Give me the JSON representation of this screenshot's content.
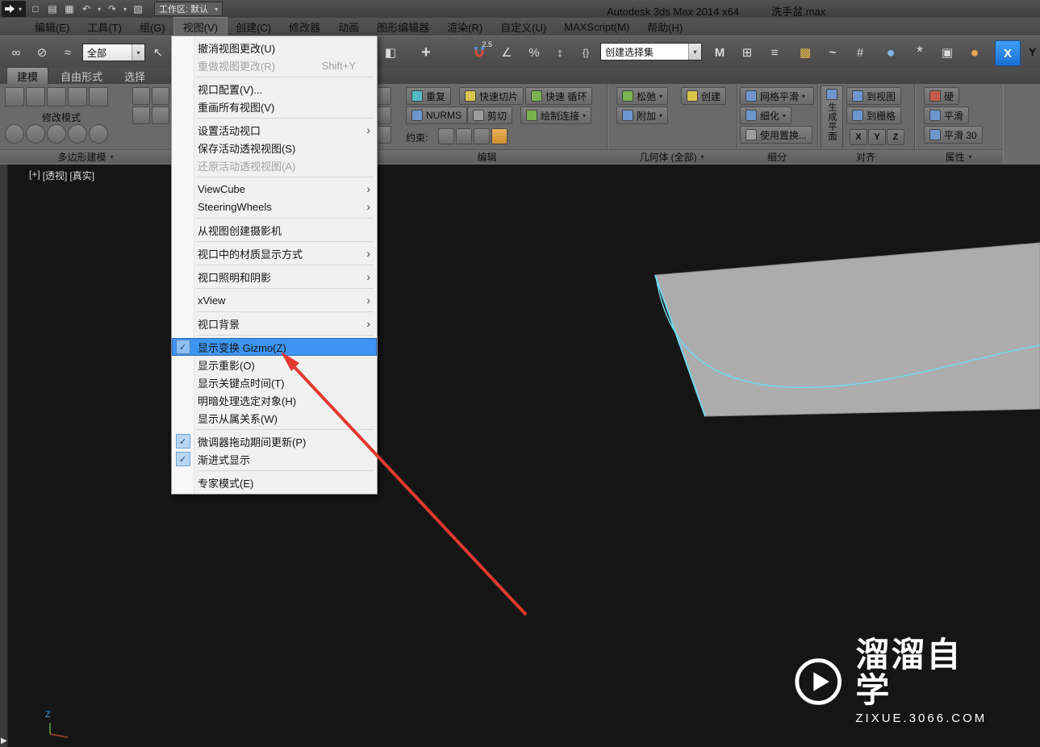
{
  "window": {
    "app_title": "Autodesk 3ds Max 2014 x64",
    "file_name": "洗手盆.max",
    "workspace_label": "工作区: 默认"
  },
  "menubar": {
    "items": [
      "编辑(E)",
      "工具(T)",
      "组(G)",
      "视图(V)",
      "创建(C)",
      "修改器",
      "动画",
      "图形编辑器",
      "渲染(R)",
      "自定义(U)",
      "MAXScript(M)",
      "帮助(H)"
    ]
  },
  "toolbar": {
    "selection_filter": "全部",
    "named_sets_value": "创建选择集",
    "snap_25": "2.5",
    "axis_x": "X",
    "axis_y": "Y"
  },
  "ribbon": {
    "tabs": [
      "建模",
      "自由形式",
      "选择"
    ],
    "polygon_panel": {
      "modify_mode": "修改模式",
      "label": "多边形建模"
    },
    "edit_panel": {
      "label": "编辑",
      "repeat": "重复",
      "quickslice": "快速切片",
      "swiftloop": "快速 循环",
      "nurms": "NURMS",
      "cut": "剪切",
      "paintconnect": "绘制连接",
      "constraints": "约束:"
    },
    "geometry_panel": {
      "label": "几何体 (全部)",
      "relax": "松弛",
      "attach": "附加",
      "create": "创建"
    },
    "subdivision_panel": {
      "label": "细分",
      "meshsmooth": "网格平滑",
      "tessellate": "细化",
      "displacement": "使用置换..."
    },
    "align_panel": {
      "label": "对齐",
      "make_planar": "生成平面",
      "to_view": "到视图",
      "to_grid": "到栅格",
      "x": "X",
      "y": "Y",
      "z": "Z"
    },
    "properties_panel": {
      "label": "属性",
      "hard": "硬",
      "smooth": "平滑",
      "smooth30": "平滑 30"
    }
  },
  "menu": {
    "items": [
      {
        "label": "撤消视图更改(U)"
      },
      {
        "label": "重做视图更改(R)",
        "shortcut": "Shift+Y",
        "disabled": true
      },
      {
        "label": "视口配置(V)..."
      },
      {
        "label": "重画所有视图(V)"
      },
      {
        "label": "设置活动视口",
        "submenu": true
      },
      {
        "label": "保存活动透视视图(S)"
      },
      {
        "label": "还原活动透视视图(A)",
        "disabled": true
      },
      {
        "label": "ViewCube",
        "submenu": true
      },
      {
        "label": "SteeringWheels",
        "submenu": true
      },
      {
        "label": "从视图创建摄影机"
      },
      {
        "label": "视口中的材质显示方式",
        "submenu": true
      },
      {
        "label": "视口照明和阴影",
        "submenu": true
      },
      {
        "label": "xView",
        "submenu": true
      },
      {
        "label": "视口背景",
        "submenu": true
      },
      {
        "label": "显示变换 Gizmo(Z)",
        "checked": true,
        "highlighted": true
      },
      {
        "label": "显示重影(O)"
      },
      {
        "label": "显示关键点时间(T)"
      },
      {
        "label": "明暗处理选定对象(H)"
      },
      {
        "label": "显示从属关系(W)"
      },
      {
        "label": "微调器拖动期间更新(P)",
        "checked": true
      },
      {
        "label": "渐进式显示",
        "checked": true
      },
      {
        "label": "专家模式(E)"
      }
    ]
  },
  "viewport": {
    "general_label": "[+]",
    "pov_label": "[透视]",
    "shading_label": "[真实]",
    "axis_z": "Z"
  },
  "watermark": {
    "name": "溜溜自学",
    "site": "ZIXUE.3066.COM"
  },
  "icons": {
    "caret": "▾",
    "submenu": "›",
    "check": "✓",
    "new_doc": "□",
    "open_folder": "▤",
    "save": "▦",
    "undo": "↶",
    "redo": "↷",
    "project_folder": "▧",
    "link": "∞",
    "unlink": "⊘",
    "spacewarp": "≈",
    "cursor": "↖",
    "window_crossing": "◧",
    "move": "+",
    "angle": "∠",
    "percent": "%",
    "spinner": "↕",
    "named_sets": "{}",
    "mirror": "M",
    "align": "⊞",
    "layers": "≡",
    "graphite": "▩",
    "curve_editor": "~",
    "schematic": "#",
    "material": "●",
    "render_setup": "*",
    "rendered_frame": "▣",
    "render_prod": "●"
  },
  "colors": {
    "menu_highlight": "#3e95f2",
    "arrow_red": "#e23a2e",
    "edge_cyan": "#6fd8ef",
    "axis_active_blue": "#1a6fd2"
  }
}
